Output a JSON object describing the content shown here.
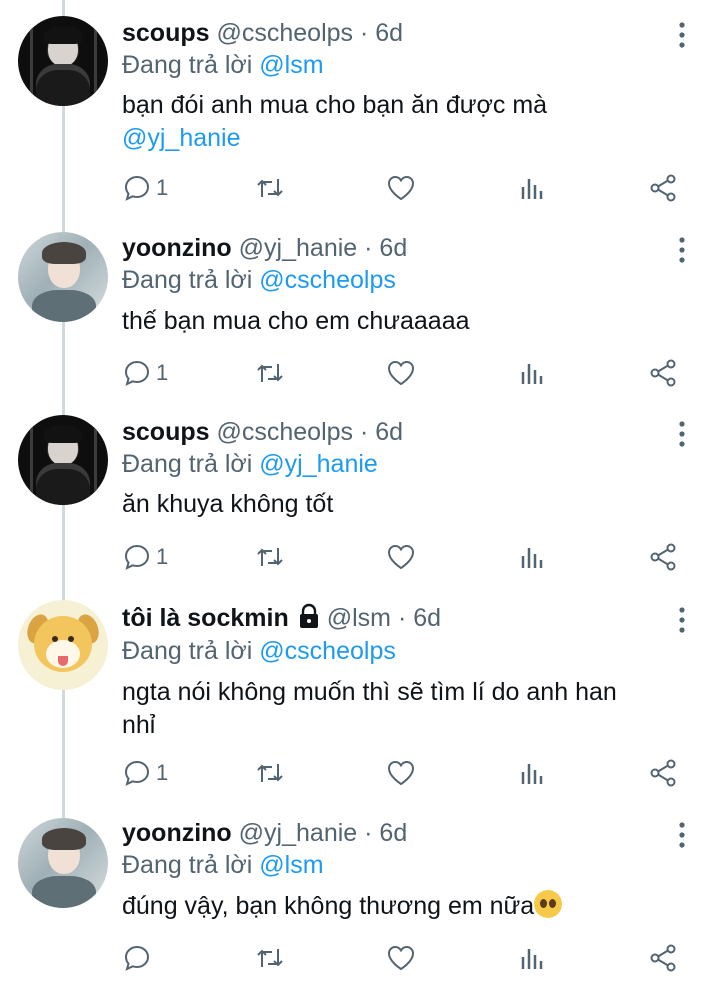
{
  "reply_prefix": "Đang trả lời",
  "tweets": [
    {
      "name": "scoups",
      "handle": "@cscheolps",
      "sep": "·",
      "time": "6d",
      "reply_to": "@lsm",
      "text_line1": "bạn đói anh mua cho bạn ăn được mà",
      "text_mention": "@yj_hanie",
      "reply_count": "1",
      "avatar": "scoups-avatar"
    },
    {
      "name": "yoonzino",
      "handle": "@yj_hanie",
      "sep": "·",
      "time": "6d",
      "reply_to": "@cscheolps",
      "text": "thế bạn mua cho em chưaaaaa",
      "reply_count": "1",
      "avatar": "yoonzino-avatar"
    },
    {
      "name": "scoups",
      "handle": "@cscheolps",
      "sep": "·",
      "time": "6d",
      "reply_to": "@yj_hanie",
      "text": "ăn khuya không tốt",
      "reply_count": "1",
      "avatar": "scoups-avatar"
    },
    {
      "name": "tôi là sockmin",
      "handle": "@lsm",
      "sep": "·",
      "time": "6d",
      "reply_to": "@cscheolps",
      "text_line1": "ngta nói không muốn thì sẽ tìm lí do anh han",
      "text_line2": "nhỉ",
      "reply_count": "1",
      "protected": true,
      "avatar": "dog-avatar"
    },
    {
      "name": "yoonzino",
      "handle": "@yj_hanie",
      "sep": "·",
      "time": "6d",
      "reply_to": "@lsm",
      "text": "đúng vậy, bạn không thương em nữa",
      "emoji": "pleading-face-emoji",
      "reply_count": "",
      "avatar": "yoonzino-avatar"
    }
  ],
  "colors": {
    "link": "#1d9bf0",
    "secondary": "#536471",
    "thread_line": "#cfd9de"
  },
  "icons": [
    "reply-icon",
    "retweet-icon",
    "like-icon",
    "analytics-icon",
    "share-icon",
    "more-icon",
    "lock-icon"
  ]
}
